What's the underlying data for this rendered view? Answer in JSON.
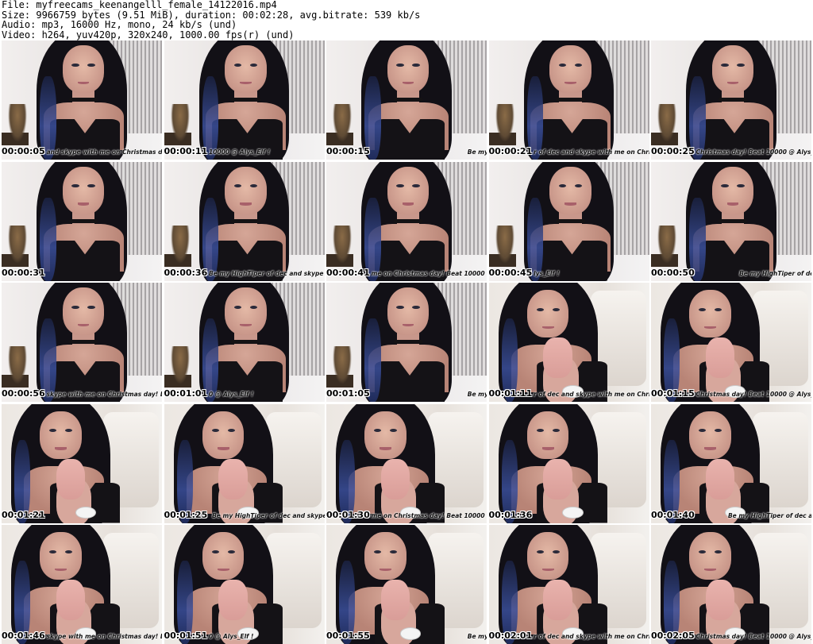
{
  "header": {
    "file_line": "File: myfreecams_keenangelll_female_14122016.mp4",
    "size_line": "Size: 9966759 bytes (9.51 MiB), duration: 00:02:28, avg.bitrate: 539 kb/s",
    "audio_line": "Audio: mp3, 16000 Hz, mono, 24 kb/s (und)",
    "video_line": "Video: h264, yuv420p, 320x240, 1000.00 fps(r) (und)"
  },
  "thumbnails": [
    {
      "timestamp": "00:00:05",
      "ticker": "and skype with me on Christmas day! Beat 10000 @ Alys_Elf !",
      "ticker_offset": 0.28,
      "scene": "room"
    },
    {
      "timestamp": "00:00:11",
      "ticker": "10000 @ Alys_Elf !",
      "ticker_offset": 0.28,
      "scene": "room"
    },
    {
      "timestamp": "00:00:15",
      "ticker": "Be my HighTiper of dec and skype with me on Christmas day!",
      "ticker_offset": 0.88,
      "scene": "room"
    },
    {
      "timestamp": "00:00:21",
      "ticker": "r of dec and skype with me on Christmas day! Beat 10000",
      "ticker_offset": 0.28,
      "scene": "room"
    },
    {
      "timestamp": "00:00:25",
      "ticker": "Christmas day! Beat 10000 @ Alys_Elf !",
      "ticker_offset": 0.28,
      "scene": "room"
    },
    {
      "timestamp": "00:00:31",
      "ticker": "",
      "ticker_offset": 0.28,
      "scene": "room"
    },
    {
      "timestamp": "00:00:36",
      "ticker": "Be my HighTiper of dec and skype with",
      "ticker_offset": 0.28,
      "scene": "room"
    },
    {
      "timestamp": "00:00:41",
      "ticker": "me on Christmas day! Beat 10000 @ Alys_Elf !",
      "ticker_offset": 0.28,
      "scene": "room"
    },
    {
      "timestamp": "00:00:45",
      "ticker": "lys_Elf !",
      "ticker_offset": 0.28,
      "scene": "room"
    },
    {
      "timestamp": "00:00:50",
      "ticker": "Be my HighTiper of dec and skype with me",
      "ticker_offset": 0.55,
      "scene": "room"
    },
    {
      "timestamp": "00:00:56",
      "ticker": "skype with me on Christmas day! Beat 10000 @ Alys_Elf !",
      "ticker_offset": 0.28,
      "scene": "room"
    },
    {
      "timestamp": "00:01:01",
      "ticker": "0 @ Alys_Elf !",
      "ticker_offset": 0.28,
      "scene": "room"
    },
    {
      "timestamp": "00:01:05",
      "ticker": "Be my HighTiper of dec and skype with me on Christmas",
      "ticker_offset": 0.88,
      "scene": "room"
    },
    {
      "timestamp": "00:01:11",
      "ticker": "r of dec and skype with me on Christmas day! Beat 10000",
      "ticker_offset": 0.28,
      "scene": "chair"
    },
    {
      "timestamp": "00:01:15",
      "ticker": "Christmas day! Beat 10000 @ Alys_Elf !",
      "ticker_offset": 0.28,
      "scene": "chair"
    },
    {
      "timestamp": "00:01:21",
      "ticker": "",
      "ticker_offset": 0.28,
      "scene": "chair"
    },
    {
      "timestamp": "00:01:25",
      "ticker": "Be my HighTiper of dec and skype",
      "ticker_offset": 0.3,
      "scene": "chair"
    },
    {
      "timestamp": "00:01:30",
      "ticker": "me on Christmas day! Beat 10000 @ Alys_Elf !",
      "ticker_offset": 0.28,
      "scene": "chair"
    },
    {
      "timestamp": "00:01:36",
      "ticker": "",
      "ticker_offset": 0.28,
      "scene": "chair"
    },
    {
      "timestamp": "00:01:40",
      "ticker": "Be my HighTiper of dec and skype with me",
      "ticker_offset": 0.48,
      "scene": "chair"
    },
    {
      "timestamp": "00:01:46",
      "ticker": "skype with me on Christmas day! Beat 10000 @ Alys_Elf !",
      "ticker_offset": 0.28,
      "scene": "chair"
    },
    {
      "timestamp": "00:01:51",
      "ticker": "0 @ Alys_Elf !",
      "ticker_offset": 0.28,
      "scene": "chair"
    },
    {
      "timestamp": "00:01:55",
      "ticker": "Be my HighTiper of dec and skype with me on Christmas",
      "ticker_offset": 0.88,
      "scene": "chair"
    },
    {
      "timestamp": "00:02:01",
      "ticker": "r of dec and skype with me on Christmas day! Beat 10000",
      "ticker_offset": 0.28,
      "scene": "chair"
    },
    {
      "timestamp": "00:02:05",
      "ticker": "Christmas day! Beat 10000 @ Alys_Elf !",
      "ticker_offset": 0.28,
      "scene": "chair"
    }
  ]
}
